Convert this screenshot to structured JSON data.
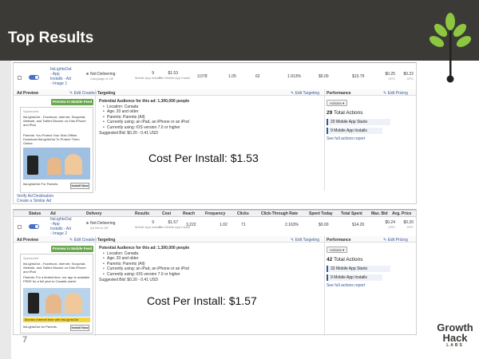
{
  "slide": {
    "title": "Top Results",
    "number": "7",
    "brand": {
      "line1": "Growth",
      "line2": "Hack",
      "line3": "LABS"
    }
  },
  "table_header": {
    "status": "Status",
    "ad": "Ad",
    "delivery": "Delivery",
    "results": "Results",
    "cost": "Cost",
    "reach": "Reach",
    "frequency": "Frequency",
    "clicks": "Clicks",
    "ctr": "Click-Through Rate",
    "spent_today": "Spent Today",
    "total_spent": "Total Spent",
    "max_bid": "Max. Bid",
    "avg_price": "Avg. Price"
  },
  "ads": [
    {
      "name_line1": "ItsLightsOut",
      "name_line2": "- App",
      "name_line3": "Installs - Ad",
      "name_line4": "- Image 1",
      "delivery": "Not Delivering",
      "delivery_sub": "Campaign is Off",
      "results": "9",
      "results_sub": "Mobile App Installs",
      "cost": "$1.53",
      "cost_sub": "Per Mobile App Install",
      "reach": "3,078",
      "frequency": "1.05",
      "clicks": "62",
      "ctr": "1.913%",
      "spent_today": "$0.00",
      "total_spent": "$13.79",
      "max_bid": "$0.25",
      "max_bid_sub": "CPC",
      "avg_price": "$0.22",
      "avg_price_sub": "CPC",
      "ad_preview_label": "Ad Preview",
      "edit_creative": "Edit Creative",
      "preview_btn": "Preview in Mobile Feed",
      "targeting_label": "Targeting",
      "edit_targeting": "Edit Targeting",
      "audience": "Potential Audience for this ad: 1,300,000 people",
      "targeting": [
        "Location: Canada",
        "Age: 20 and older",
        "Parents: Parents (All)",
        "Currently using: an iPad, an iPhone or an iPod",
        "Currently using: iOS version 7.0 or higher"
      ],
      "suggested_bid": "Suggested Bid: $0.20 - 0.41 USD",
      "performance_label": "Performance",
      "edit_pricing": "Edit Pricing",
      "actions_btn": "Actions",
      "total_actions_num": "29",
      "total_actions_label": "Total Actions",
      "stat1": "20 Mobile App Starts",
      "stat2": "9 Mobile App Installs",
      "see_full": "See full actions report",
      "ad_title": "ItsLightsOut - Facebook, Internet, Snapchat, Website, and Twitter Blocker on Kids iPhone and iPad",
      "ad_sponsored": "Sponsored",
      "ad_body": "Parents: You Protect Your Kids Offline. Download ItsLightsOut To Protect Them Online.",
      "ad_footer_name": "ItsLightsOut For Parents",
      "install_btn": "Install Now",
      "verify": "Verify Ad Destination",
      "create_similar": "Create a Similar Ad",
      "cost_caption": "Cost Per Install: $1.53"
    },
    {
      "name_line1": "ItsLightsOut",
      "name_line2": "- App",
      "name_line3": "Installs - Ad",
      "name_line4": "- Image 2",
      "delivery": "Not Delivering",
      "delivery_sub": "Ad Set is Off",
      "results": "9",
      "results_sub": "Mobile App Installs",
      "cost": "$1.57",
      "cost_sub": "Per Mobile App Install",
      "reach": "3,222",
      "frequency": "1.02",
      "clicks": "71",
      "ctr": "2.163%",
      "spent_today": "$0.00",
      "total_spent": "$14.20",
      "max_bid": "$0.24",
      "max_bid_sub": "CPC",
      "avg_price": "$0.20",
      "avg_price_sub": "CPC",
      "ad_preview_label": "Ad Preview",
      "edit_creative": "Edit Creative",
      "preview_btn": "Preview in Mobile Feed",
      "targeting_label": "Targeting",
      "edit_targeting": "Edit Targeting",
      "audience": "Potential Audience for this ad: 1,300,000 people",
      "targeting": [
        "Location: Canada",
        "Age: 20 and older",
        "Parents: Parents (All)",
        "Currently using: an iPad, an iPhone or an iPod",
        "Currently using: iOS version 7.0 or higher"
      ],
      "suggested_bid": "Suggested Bid: $0.20 - 0.41 USD",
      "performance_label": "Performance",
      "edit_pricing": "Edit Pricing",
      "actions_btn": "Actions",
      "total_actions_num": "42",
      "total_actions_label": "Total Actions",
      "stat1": "33 Mobile App Starts",
      "stat2": "9 Mobile App Installs",
      "see_full": "See full actions report",
      "ad_title": "ItsLightsOut - Facebook, Internet, Snapchat, Website, and Twitter Blocker on Kids iPhone and iPad",
      "ad_sponsored": "Sponsored",
      "ad_body": "Parents: For a limited time, our app is available FREE for a full year to Canada users!",
      "ad_banner": "Monitor internet time with ItsLightsOut",
      "ad_footer_name": "ItsLightsOut for Parents",
      "install_btn": "Install Now",
      "cost_caption": "Cost Per Install: $1.57"
    }
  ],
  "colors": {
    "topbar": "#3c3a37",
    "leaf": "#8dc63f",
    "accent": "#3b5998",
    "preview_green": "#6aa84f"
  }
}
